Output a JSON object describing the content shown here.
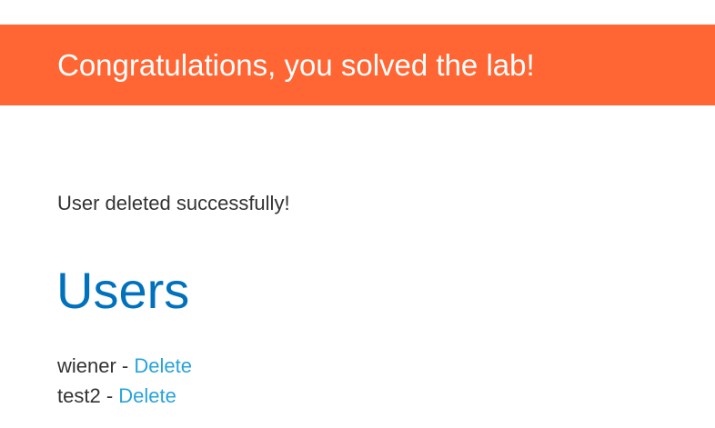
{
  "banner": {
    "message": "Congratulations, you solved the lab!",
    "color": "#ff6633"
  },
  "status_message": "User deleted successfully!",
  "users_heading": "Users",
  "users": [
    {
      "name": "wiener",
      "separator": " - ",
      "delete_label": "Delete"
    },
    {
      "name": "test2",
      "separator": " - ",
      "delete_label": "Delete"
    }
  ],
  "colors": {
    "heading": "#0071bc",
    "link": "#29a3da",
    "text": "#333333"
  }
}
